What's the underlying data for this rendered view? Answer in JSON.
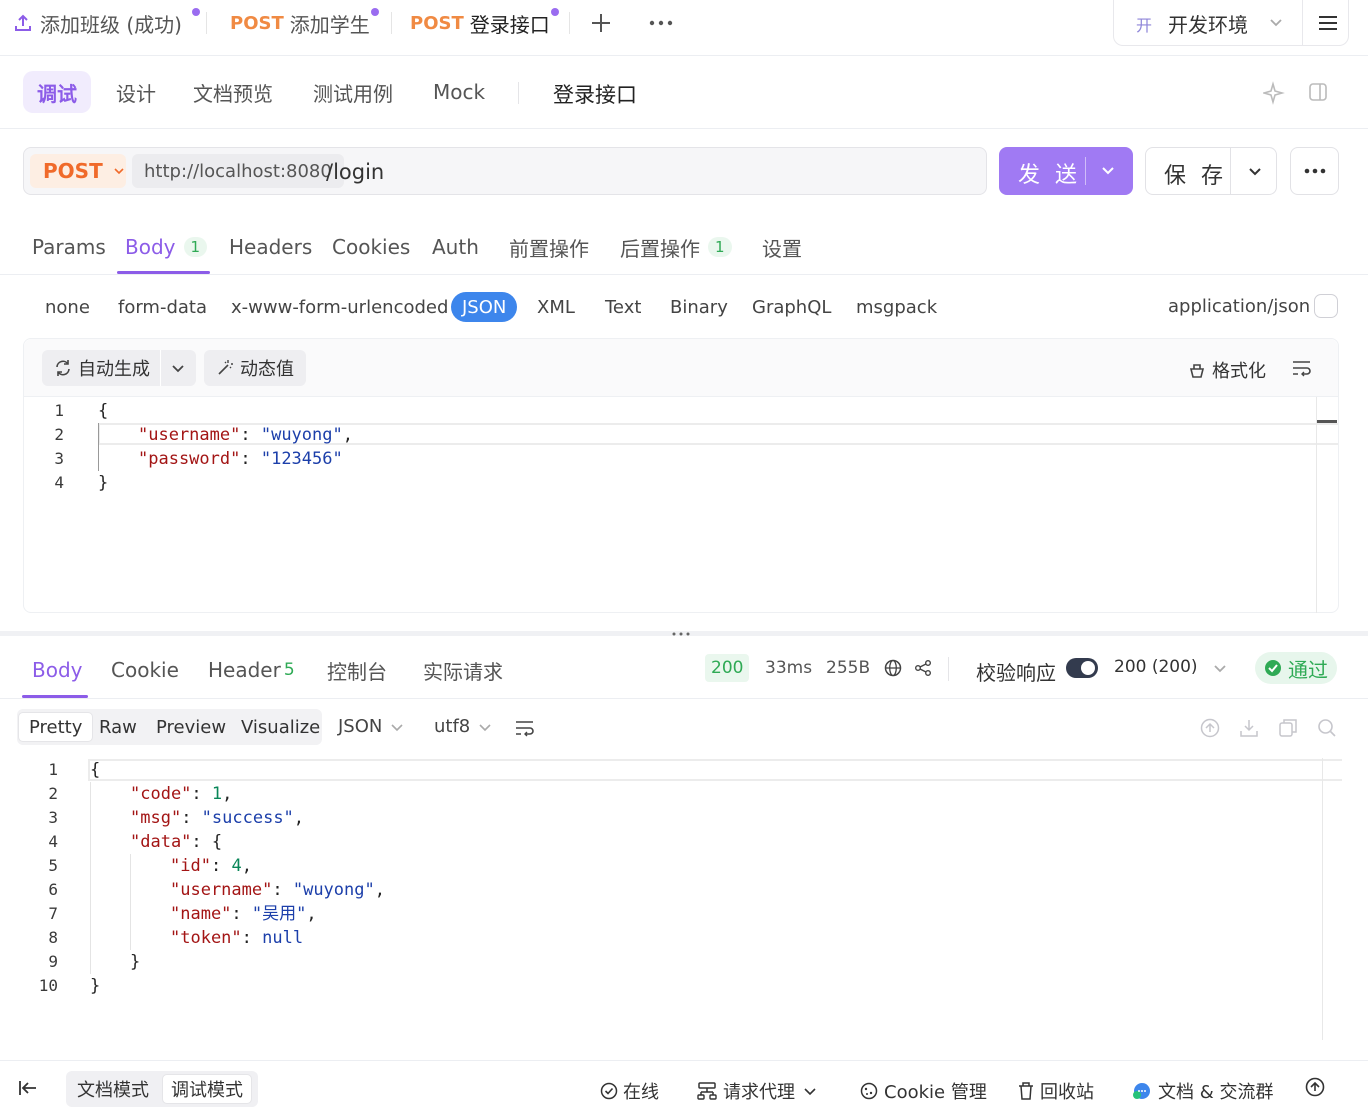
{
  "tabs": [
    {
      "method": "",
      "label": "添加班级 (成功)"
    },
    {
      "method": "POST",
      "label": "添加学生"
    },
    {
      "method": "POST",
      "label": "登录接口"
    }
  ],
  "environment": {
    "badge": "开",
    "label": "开发环境"
  },
  "modes": [
    "调试",
    "设计",
    "文档预览",
    "测试用例",
    "Mock"
  ],
  "api_name": "登录接口",
  "request": {
    "method": "POST",
    "base_url": "http://localhost:8080",
    "path": "/login",
    "send_label": "发 送",
    "save_label": "保 存"
  },
  "request_tabs": {
    "params": "Params",
    "body": "Body",
    "body_count": "1",
    "headers": "Headers",
    "cookies": "Cookies",
    "auth": "Auth",
    "pre": "前置操作",
    "post": "后置操作",
    "post_count": "1",
    "settings": "设置"
  },
  "body_types": [
    "none",
    "form-data",
    "x-www-form-urlencoded",
    "JSON",
    "XML",
    "Text",
    "Binary",
    "GraphQL",
    "msgpack"
  ],
  "content_type": "application/json",
  "editor_toolbar": {
    "auto_generate": "自动生成",
    "dynamic_value": "动态值",
    "format": "格式化"
  },
  "request_body_lines": [
    {
      "num": "1",
      "text": "{"
    },
    {
      "num": "2",
      "key": "\"username\"",
      "value": "\"wuyong\"",
      "tail": ","
    },
    {
      "num": "3",
      "key": "\"password\"",
      "value": "\"123456\"",
      "tail": ""
    },
    {
      "num": "4",
      "text": "}"
    }
  ],
  "response_tabs": {
    "body": "Body",
    "cookie": "Cookie",
    "header": "Header",
    "header_count": "5",
    "console": "控制台",
    "actual": "实际请求"
  },
  "response_meta": {
    "status": "200",
    "time": "33ms",
    "size": "255B",
    "verify_label": "校验响应",
    "verify_value": "200 (200)",
    "pass": "通过"
  },
  "response_formats": [
    "Pretty",
    "Raw",
    "Preview",
    "Visualize"
  ],
  "response_lang": "JSON",
  "response_encoding": "utf8",
  "response_lines": [
    {
      "num": "1",
      "text": "{"
    },
    {
      "num": "2",
      "key": "\"code\"",
      "num_value": "1",
      "tail": ","
    },
    {
      "num": "3",
      "key": "\"msg\"",
      "value": "\"success\"",
      "tail": ","
    },
    {
      "num": "4",
      "key": "\"data\"",
      "text_tail": ": {"
    },
    {
      "num": "5",
      "key": "\"id\"",
      "num_value": "4",
      "tail": ","
    },
    {
      "num": "6",
      "key": "\"username\"",
      "value": "\"wuyong\"",
      "tail": ","
    },
    {
      "num": "7",
      "key": "\"name\"",
      "value": "\"吴用\"",
      "tail": ","
    },
    {
      "num": "8",
      "key": "\"token\"",
      "kw_value": "null",
      "tail": ""
    },
    {
      "num": "9",
      "text": "}"
    },
    {
      "num": "10",
      "text": "}"
    }
  ],
  "footer": {
    "doc_mode": "文档模式",
    "debug_mode": "调试模式",
    "online": "在线",
    "proxy": "请求代理",
    "cookie": "Cookie 管理",
    "trash": "回收站",
    "community": "文档 & 交流群"
  }
}
